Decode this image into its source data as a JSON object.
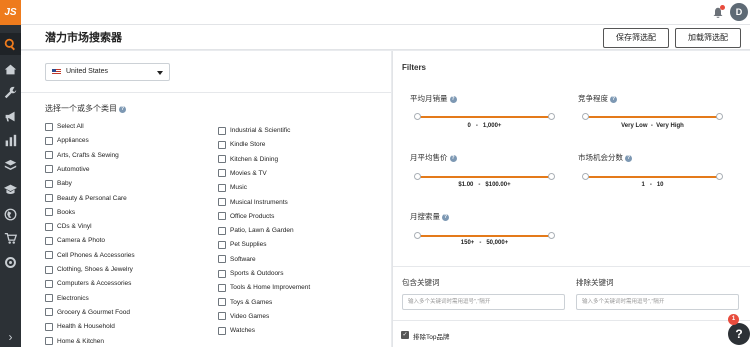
{
  "app": {
    "logo_text": "JS",
    "user_initial": "D",
    "help_badge": "1",
    "help_symbol": "?"
  },
  "header": {
    "title": "潜力市场搜索器",
    "save_label": "保存筛选配置",
    "load_label": "加载筛选配置"
  },
  "market": {
    "selected": "United States"
  },
  "categories": {
    "label": "选择一个或多个类目",
    "left": [
      "Select All",
      "Appliances",
      "Arts, Crafts & Sewing",
      "Automotive",
      "Baby",
      "Beauty & Personal Care",
      "Books",
      "CDs & Vinyl",
      "Camera & Photo",
      "Cell Phones & Accessories",
      "Clothing, Shoes & Jewelry",
      "Computers & Accessories",
      "Electronics",
      "Grocery & Gourmet Food",
      "Health & Household",
      "Home & Kitchen"
    ],
    "right": [
      "Industrial & Scientific",
      "Kindle Store",
      "Kitchen & Dining",
      "Movies & TV",
      "Music",
      "Musical Instruments",
      "Office Products",
      "Patio, Lawn & Garden",
      "Pet Supplies",
      "Software",
      "Sports & Outdoors",
      "Tools & Home Improvement",
      "Toys & Games",
      "Video Games",
      "Watches"
    ]
  },
  "filters": {
    "title": "Filters",
    "monthly_sales": {
      "label": "平均月销量",
      "min": "0",
      "sep": "-",
      "max": "1,000+"
    },
    "competition": {
      "label": "竞争程度",
      "min": "Very Low",
      "sep": "-",
      "max": "Very High"
    },
    "avg_price": {
      "label": "月平均售价",
      "min": "$1.00",
      "sep": "-",
      "max": "$100.00+"
    },
    "opportunity": {
      "label": "市场机会分数",
      "min": "1",
      "sep": "-",
      "max": "10"
    },
    "search_volume": {
      "label": "月搜索量",
      "min": "150+",
      "sep": "-",
      "max": "50,000+"
    },
    "include_keywords": {
      "label": "包含关键词",
      "placeholder": "输入多个关键词时需用逗号\",\"隔开"
    },
    "exclude_keywords": {
      "label": "排除关键词",
      "placeholder": "输入多个关键词时需用逗号\",\"隔开"
    },
    "exclude_top_brands": {
      "label": "排除Top品牌",
      "checked": true
    }
  },
  "colors": {
    "accent": "#ee7b1d",
    "sidebar": "#2c3136"
  },
  "icons": {
    "sidebar": [
      "search-icon",
      "home-icon",
      "wrench-icon",
      "megaphone-icon",
      "bar-chart-icon",
      "stack-icon",
      "graduation-cap-icon",
      "globe-icon",
      "cart-icon",
      "settings-icon"
    ]
  }
}
